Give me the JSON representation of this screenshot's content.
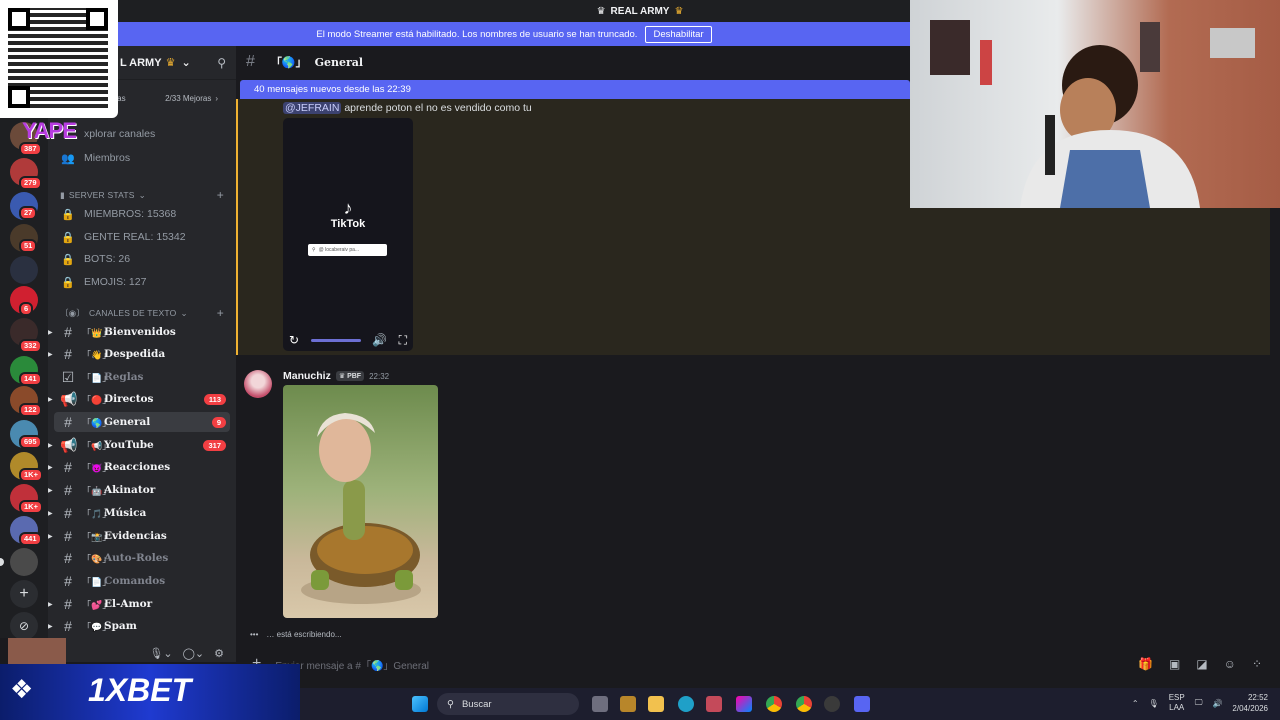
{
  "topbar": {
    "server_title": "REAL ARMY"
  },
  "streamer": {
    "message": "El modo Streamer está habilitado. Los nombres de usuario se han truncado.",
    "button": "Deshabilitar"
  },
  "server": {
    "name_fragment": "L ARMY",
    "boost_label": "2/33 Mejoras",
    "boost_prefix": "oras"
  },
  "overlay": {
    "yape": "YAPE",
    "bet": "1XBET"
  },
  "sidebar": {
    "explore": "xplorar canales",
    "members": "Miembros",
    "stats_category": "SERVER STATS",
    "stats": [
      "MIEMBROS: 15368",
      "GENTE REAL: 15342",
      "BOTS: 26",
      "EMOJIS: 127"
    ],
    "text_category": "CANALES DE TEXTO",
    "channels": [
      {
        "name": "Bienvenidos",
        "emo": "「👑」"
      },
      {
        "name": "Despedida",
        "emo": "「👋」"
      },
      {
        "name": "Reglas",
        "emo": "「📄」"
      },
      {
        "name": "Directos",
        "emo": "「🔴」",
        "badge": "113"
      },
      {
        "name": "General",
        "emo": "「🌎」",
        "badge": "9"
      },
      {
        "name": "YouTube",
        "emo": "「📢」",
        "badge": "317"
      },
      {
        "name": "Reacciones",
        "emo": "「😈」"
      },
      {
        "name": "Akinator",
        "emo": "「🤖」"
      },
      {
        "name": "Música",
        "emo": "「🎵」"
      },
      {
        "name": "Evidencias",
        "emo": "「📸」"
      },
      {
        "name": "Auto-Roles",
        "emo": "「🎨」"
      },
      {
        "name": "Comandos",
        "emo": "「📄」"
      },
      {
        "name": "El-Amor",
        "emo": "「💕」"
      },
      {
        "name": "Spam",
        "emo": "「💬」"
      }
    ]
  },
  "guild_badges": [
    "387",
    "279",
    "27",
    "51",
    "6",
    "332",
    "141",
    "122",
    "695",
    "1K+",
    "1K+",
    "441"
  ],
  "channel": {
    "name": "General",
    "prefix": "「🌎」"
  },
  "banner": "40 mensajes nuevos desde las 22:39",
  "messages": {
    "first": {
      "mention": "@JEFRAIN",
      "text": " aprende poton el no es vendido como tu"
    },
    "tiktok": {
      "brand": "TikTok",
      "search": "@ locaberaiv pa..."
    },
    "second": {
      "author": "Manuchiz",
      "tag": "PBF",
      "time": "22:32"
    }
  },
  "typing": "… está escribiendo...",
  "composer": {
    "placeholder": "Enviar mensaje a #「🌎」General"
  },
  "taskbar": {
    "search": "Buscar",
    "lang": "ESP",
    "lang2": "LAA",
    "time": "22:52",
    "date": "2/04/2026"
  }
}
